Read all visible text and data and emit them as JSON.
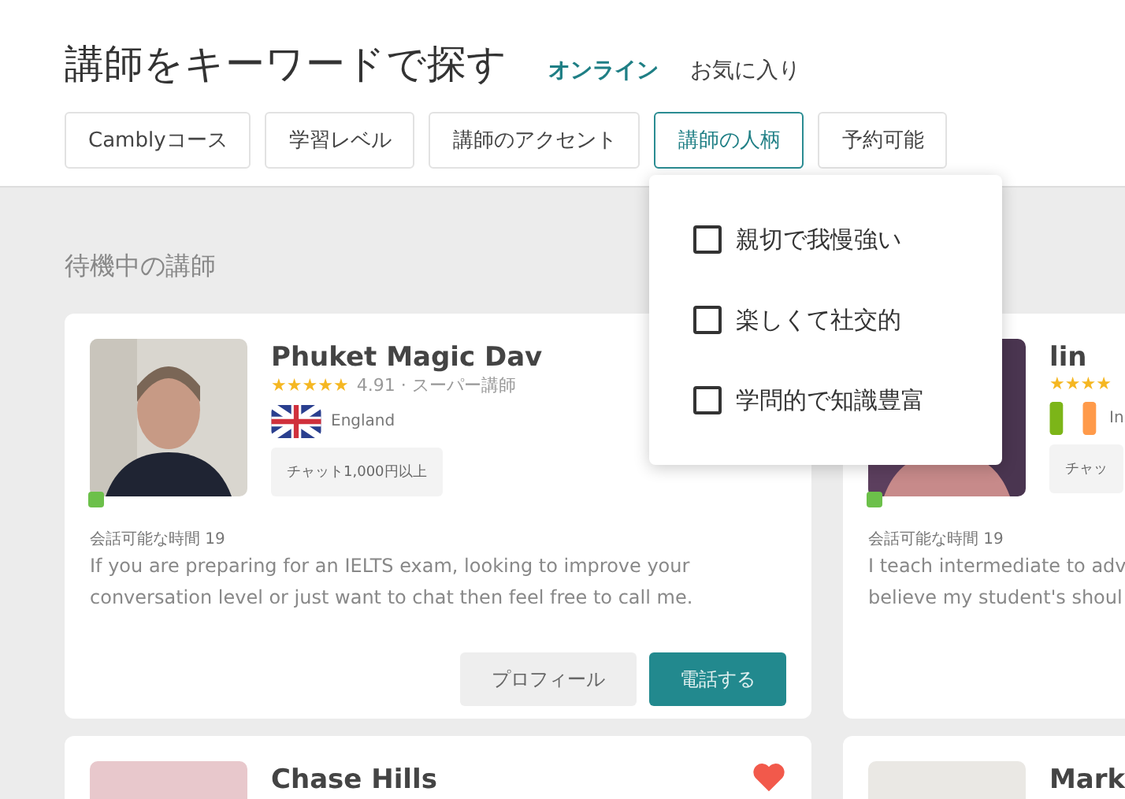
{
  "header": {
    "title": "講師をキーワードで探す",
    "tabs": [
      {
        "label": "オンライン",
        "selected": true
      },
      {
        "label": "お気に入り",
        "selected": false
      }
    ]
  },
  "filters": [
    {
      "label": "Camblyコース",
      "selected": false
    },
    {
      "label": "学習レベル",
      "selected": false
    },
    {
      "label": "講師のアクセント",
      "selected": false
    },
    {
      "label": "講師の人柄",
      "selected": true
    },
    {
      "label": "予約可能",
      "selected": false
    }
  ],
  "dropdown": {
    "options": [
      {
        "label": "親切で我慢強い",
        "checked": false
      },
      {
        "label": "楽しくて社交的",
        "checked": false
      },
      {
        "label": "学問的で知識豊富",
        "checked": false
      }
    ]
  },
  "section_title": "待機中の講師",
  "tutors": [
    {
      "name": "Phuket Magic Dav",
      "stars": 5,
      "rating": "4.91 · スーパー講師",
      "country": "England",
      "flag": {
        "kind": "uk"
      },
      "chip": "チャット1,000円以上",
      "online": true,
      "availability": "会話可能な時間 19",
      "description": [
        "If you are preparing for an IELTS exam, looking to improve your",
        "conversation level or just want to chat then feel free to call me."
      ],
      "buttons": [
        "プロフィール",
        "電話する"
      ]
    },
    {
      "name": "lin",
      "stars": 4,
      "country": "In",
      "flag": {
        "kind": "bars"
      },
      "chip": "チャッ",
      "online": true,
      "availability": "会話可能な時間 19",
      "description": [
        "I teach intermediate to adv",
        "believe my student's shoul"
      ]
    }
  ],
  "more_tutors": [
    {
      "name": "Chase Hills",
      "favorite": true
    },
    {
      "name": "Mark",
      "favorite": false
    }
  ]
}
